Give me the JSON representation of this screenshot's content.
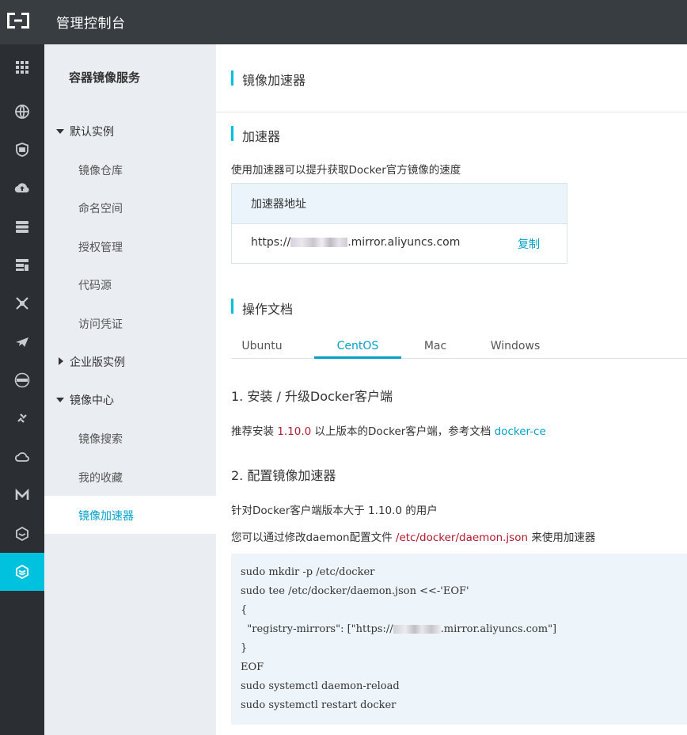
{
  "topbar": {
    "title": "管理控制台"
  },
  "rail": {
    "items": [
      "apps-grid-icon",
      "globe-icon",
      "shield-icon",
      "cloud-upload-icon",
      "database-icon",
      "server-stack-icon",
      "network-icon",
      "plane-icon",
      "dns-icon",
      "link-icon",
      "cloud-icon",
      "m-logo-icon",
      "cube-icon",
      "container-registry-icon"
    ],
    "active_index": 13,
    "accent": "#00c1de"
  },
  "sidebar": {
    "service_title": "容器镜像服务",
    "groups": [
      {
        "label": "默认实例",
        "expanded": true,
        "items": [
          "镜像仓库",
          "命名空间",
          "授权管理",
          "代码源",
          "访问凭证"
        ]
      },
      {
        "label": "企业版实例",
        "expanded": false,
        "items": []
      },
      {
        "label": "镜像中心",
        "expanded": true,
        "items": [
          "镜像搜索",
          "我的收藏",
          "镜像加速器"
        ]
      }
    ],
    "active_item": "镜像加速器"
  },
  "main": {
    "page_title": "镜像加速器",
    "accelerator": {
      "section_title": "加速器",
      "description": "使用加速器可以提升获取Docker官方镜像的速度",
      "box_header": "加速器地址",
      "url_prefix": "https://",
      "url_suffix": ".mirror.aliyuncs.com",
      "copy_label": "复制"
    },
    "docs": {
      "section_title": "操作文档",
      "tabs": [
        "Ubuntu",
        "CentOS",
        "Mac",
        "Windows"
      ],
      "active_tab": "CentOS",
      "step1": {
        "title": "1. 安装 / 升级Docker客户端",
        "text_before": "推荐安装 ",
        "version": "1.10.0",
        "text_after": " 以上版本的Docker客户端，参考文档 ",
        "link": "docker-ce"
      },
      "step2": {
        "title": "2. 配置镜像加速器",
        "line1": "针对Docker客户端版本大于 1.10.0 的用户",
        "line2_before": "您可以通过修改daemon配置文件 ",
        "config_path": "/etc/docker/daemon.json",
        "line2_after": " 来使用加速器"
      },
      "code": {
        "l1": "sudo mkdir -p /etc/docker",
        "l2": "sudo tee /etc/docker/daemon.json <<-'EOF'",
        "l3": "{",
        "l4_before": "  \"registry-mirrors\": [\"https://",
        "l4_after": ".mirror.aliyuncs.com\"]",
        "l5": "}",
        "l6": "EOF",
        "l7": "sudo systemctl daemon-reload",
        "l8": "sudo systemctl restart docker"
      }
    }
  }
}
